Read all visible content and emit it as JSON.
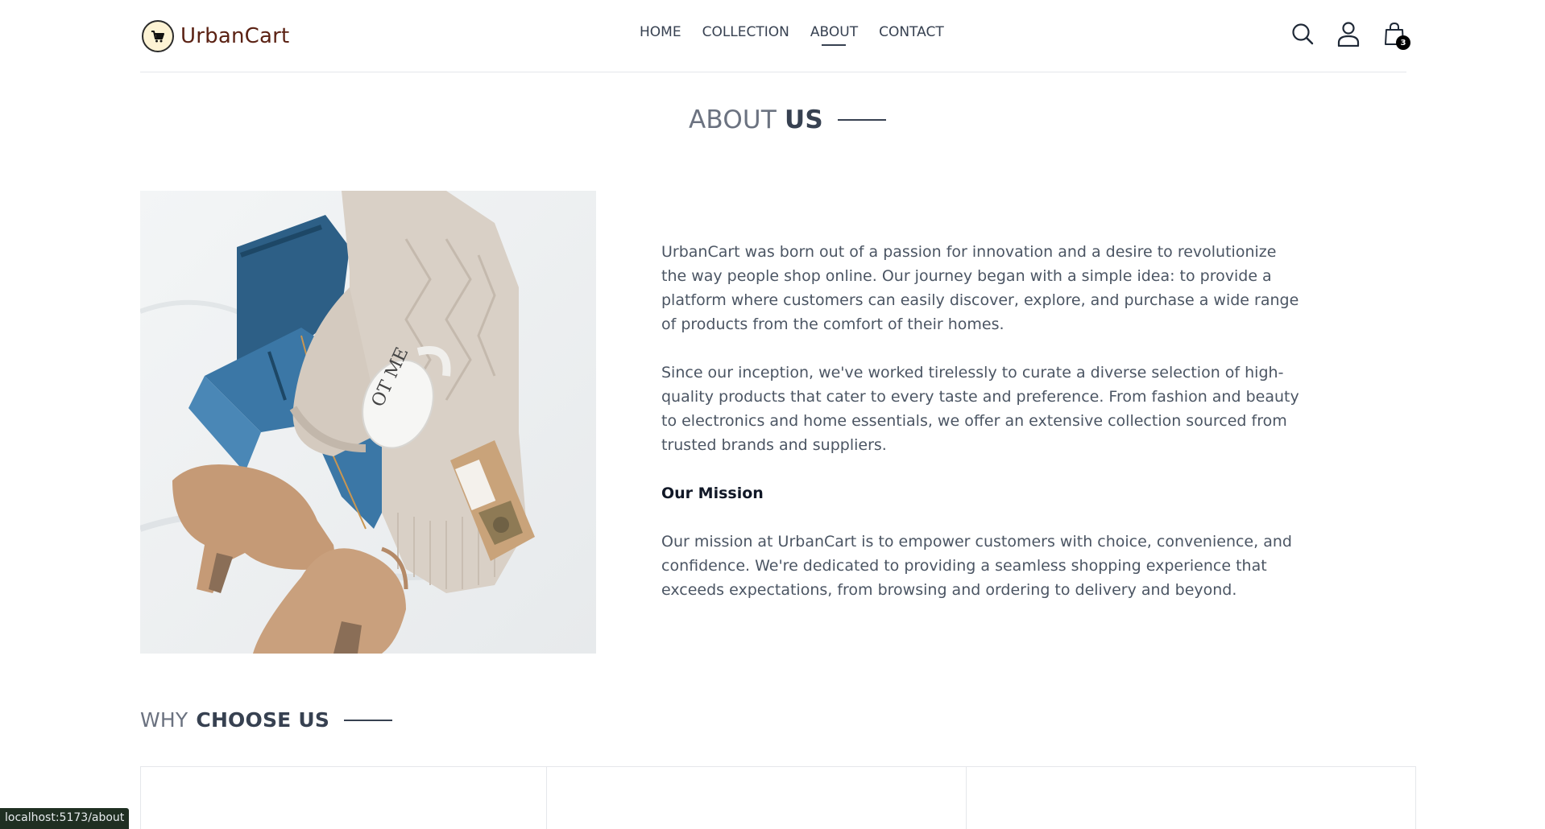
{
  "brand": {
    "name": "UrbanCart"
  },
  "nav": {
    "items": [
      {
        "label": "HOME"
      },
      {
        "label": "COLLECTION"
      },
      {
        "label": "ABOUT",
        "active": true
      },
      {
        "label": "CONTACT"
      }
    ]
  },
  "header_icons": {
    "search": "search-icon",
    "profile": "user-icon",
    "cart": "shopping-bag-icon",
    "cart_count": "3"
  },
  "about": {
    "title_light": "ABOUT",
    "title_strong": "US",
    "image_alt": "Flat lay of jeans, knit sweater, mug, tea pouch and suede boots",
    "paragraph_1": "UrbanCart was born out of a passion for innovation and a desire to revolutionize the way people shop online. Our journey began with a simple idea: to provide a platform where customers can easily discover, explore, and purchase a wide range of products from the comfort of their homes.",
    "paragraph_2": "Since our inception, we've worked tirelessly to curate a diverse selection of high-quality products that cater to every taste and preference. From fashion and beauty to electronics and home essentials, we offer an extensive collection sourced from trusted brands and suppliers.",
    "mission_heading": "Our Mission",
    "mission_text": "Our mission at UrbanCart is to empower customers with choice, convenience, and confidence. We're dedicated to providing a seamless shopping experience that exceeds expectations, from browsing and ordering to delivery and beyond."
  },
  "why": {
    "title_light": "WHY",
    "title_strong": "CHOOSE US"
  },
  "status_bar": {
    "url": "localhost:5173/about"
  },
  "colors": {
    "brand_text": "#5b2214",
    "logo_badge": "#fdf3d4",
    "body_text": "#4b5563",
    "heading_text": "#374151"
  }
}
